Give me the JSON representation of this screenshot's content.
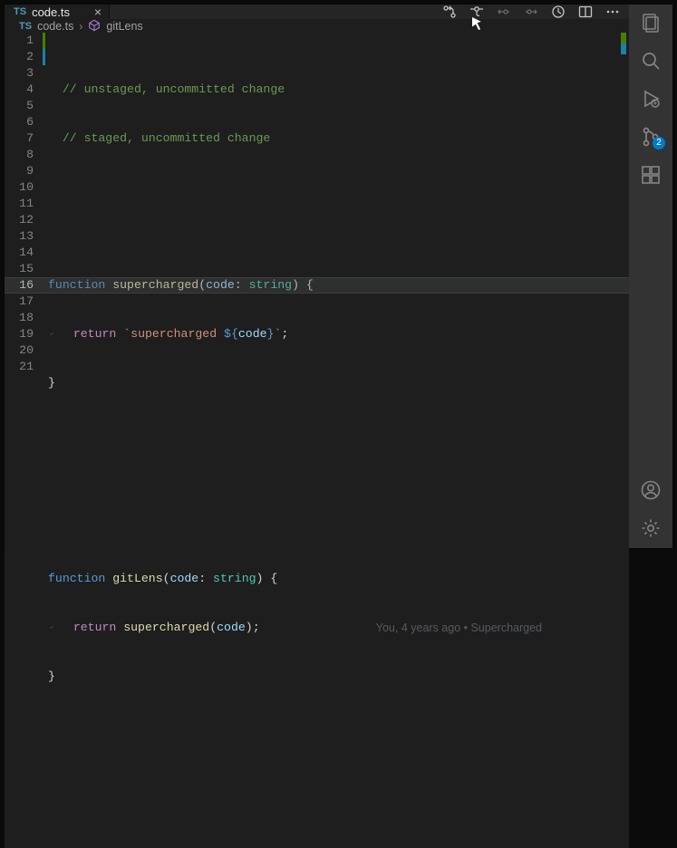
{
  "tab": {
    "language": "TS",
    "label": "code.ts"
  },
  "breadcrumb": {
    "file_lang": "TS",
    "file": "code.ts",
    "symbol": "gitLens"
  },
  "blame": "You, 4 years ago • Supercharged",
  "badge_scm": "2",
  "current_line": 16,
  "lines": [
    {
      "n": 1,
      "deco": "g"
    },
    {
      "n": 2,
      "deco": "b"
    },
    {
      "n": 3
    },
    {
      "n": 4
    },
    {
      "n": 5
    },
    {
      "n": 6
    },
    {
      "n": 7
    },
    {
      "n": 8
    },
    {
      "n": 9
    },
    {
      "n": 10
    },
    {
      "n": 11
    },
    {
      "n": 12
    },
    {
      "n": 13
    },
    {
      "n": 14
    },
    {
      "n": 15
    },
    {
      "n": 16
    },
    {
      "n": 17
    },
    {
      "n": 18
    },
    {
      "n": 19
    },
    {
      "n": 20
    },
    {
      "n": 21
    }
  ],
  "code": {
    "l1": "// unstaged, uncommitted change",
    "l2": "// staged, uncommitted change",
    "l5_kw": "function",
    "l5_fn": "supercharged",
    "l5_p1": "(",
    "l5_arg": "code",
    "l5_colon": ": ",
    "l5_typ": "string",
    "l5_p2": ") {",
    "l6_kw": "return",
    "l6_bt1": "`",
    "l6_s1": "supercharged ",
    "l6_d1": "${",
    "l6_v": "code",
    "l6_d2": "}",
    "l6_bt2": "`",
    "l6_semi": ";",
    "l7": "}",
    "l15_kw": "function",
    "l15_fn": "gitLens",
    "l15_p1": "(",
    "l15_arg": "code",
    "l15_colon": ": ",
    "l15_typ": "string",
    "l15_p2": ") {",
    "l16_kw": "return",
    "l16_fn": "supercharged",
    "l16_p1": "(",
    "l16_arg": "code",
    "l16_p2": ")",
    "l16_semi": ";",
    "l17": "}"
  }
}
